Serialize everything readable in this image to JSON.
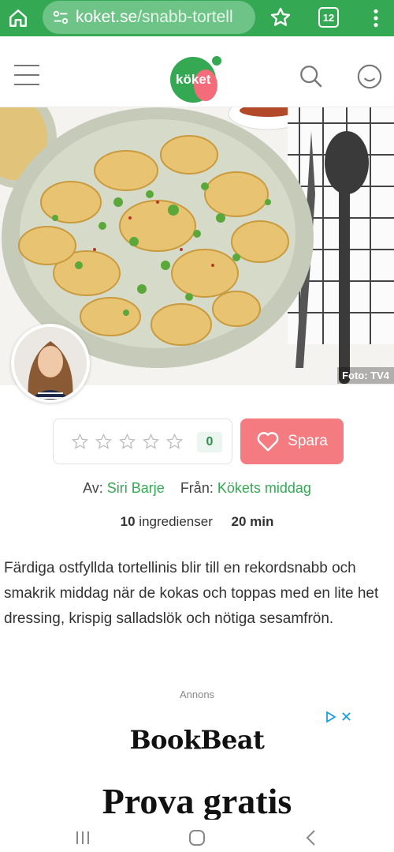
{
  "browser": {
    "url_host": "koket.se",
    "url_path": "/snabb-tortell",
    "tab_count": "12",
    "home_icon": "home-icon",
    "site_settings_icon": "site-settings-icon",
    "star_icon": "star-icon",
    "more_icon": "more-vert-icon"
  },
  "header": {
    "logo_text": "köket",
    "brand_color": "#35a854",
    "accent_color": "#f46c7a"
  },
  "hero": {
    "photo_credit": "Foto: TV4"
  },
  "rating": {
    "stars_total": 5,
    "stars_filled": 0,
    "count": "0"
  },
  "save": {
    "label": "Spara"
  },
  "byline": {
    "author_prefix": "Av:",
    "author": "Siri Barje",
    "source_prefix": "Från:",
    "source": "Kökets middag"
  },
  "meta": {
    "ingredients_count": "10",
    "ingredients_label": "ingredienser",
    "time": "20 min"
  },
  "description": "Färdiga ostfyllda tortellinis blir till en rekordsnabb och smakrik middag när de kokas och toppas med en lite het dressing, krispig salladslök och nötiga sesamfrön.",
  "ad": {
    "label": "Annons",
    "brand": "BookBeat",
    "headline": "Prova gratis"
  }
}
